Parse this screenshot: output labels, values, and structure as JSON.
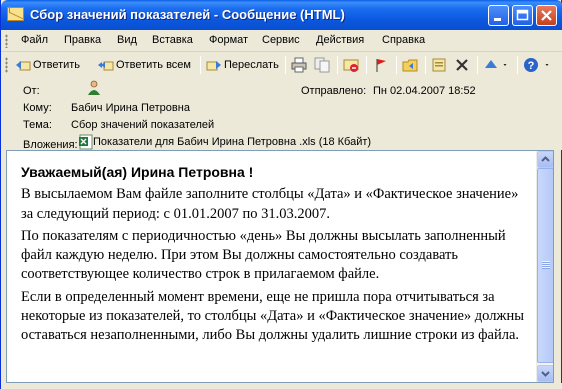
{
  "window": {
    "title": "Сбор значений показателей - Сообщение (HTML)"
  },
  "menu": {
    "items": [
      "Файл",
      "Правка",
      "Вид",
      "Вставка",
      "Формат",
      "Сервис",
      "Действия",
      "Справка"
    ]
  },
  "toolbar": {
    "reply": "Ответить",
    "reply_all": "Ответить всем",
    "forward": "Переслать"
  },
  "header": {
    "from_label": "От:",
    "sent_label": "Отправлено:",
    "sent_value": "Пн 02.04.2007 18:52",
    "to_label": "Кому:",
    "to_value": "Бабич Ирина Петровна",
    "subject_label": "Тема:",
    "subject_value": "Сбор значений показателей",
    "attachments_label": "Вложения:",
    "attachment_name": "Показатели для Бабич Ирина Петровна .xls (18 Кбайт)"
  },
  "message": {
    "greeting": "Уважаемый(ая) Ирина Петровна !",
    "paragraphs": [
      "В высылаемом Вам файле заполните столбцы «Дата» и «Фактическое значение» за следующий период: с 01.01.2007 по 31.03.2007.",
      "По показателям с периодичностью «день» Вы должны высылать заполненный файл каждую неделю. При этом Вы должны самостоятельно создавать соответствующее количество строк в прилагаемом файле.",
      "Если в определенный момент времени, еще не пришла пора отчитываться за некоторые из показателей, то столбцы «Дата» и «Фактическое значение» должны оставаться незаполненными, либо Вы должны удалить лишние строки из файла."
    ]
  }
}
